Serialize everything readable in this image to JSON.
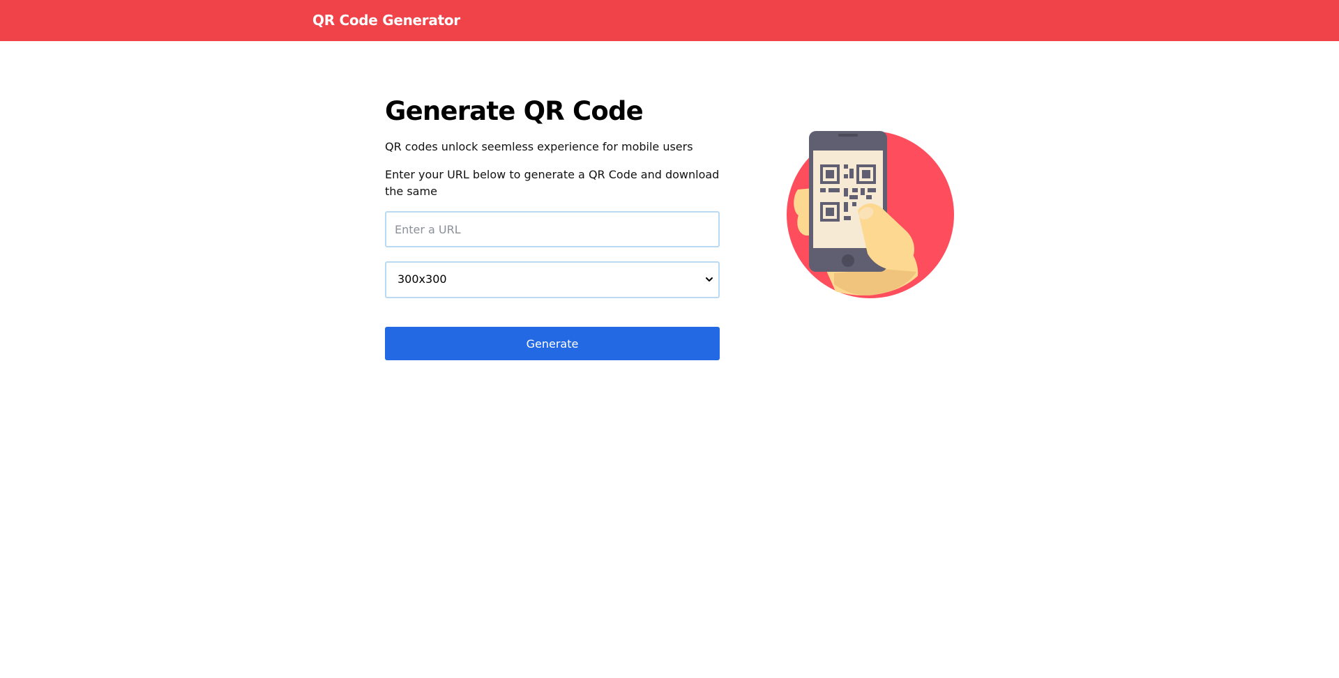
{
  "header": {
    "brand": "QR Code Generator",
    "bg_color": "#ef4349"
  },
  "main": {
    "title": "Generate QR Code",
    "subtitle": "QR codes unlock seemless experience for mobile users",
    "instructions": "Enter your URL below to generate a QR Code and download the same",
    "url_input": {
      "value": "",
      "placeholder": "Enter a URL"
    },
    "size_select": {
      "selected": "300x300"
    },
    "generate_button": {
      "label": "Generate",
      "color": "#2469e4"
    }
  },
  "illustration": {
    "icon": "hand-holding-phone-qr-icon",
    "colors": {
      "circle": "#fe4d5c",
      "phone": "#5f5f71",
      "screen": "#f7ead5",
      "hand": "#fdd891"
    }
  }
}
